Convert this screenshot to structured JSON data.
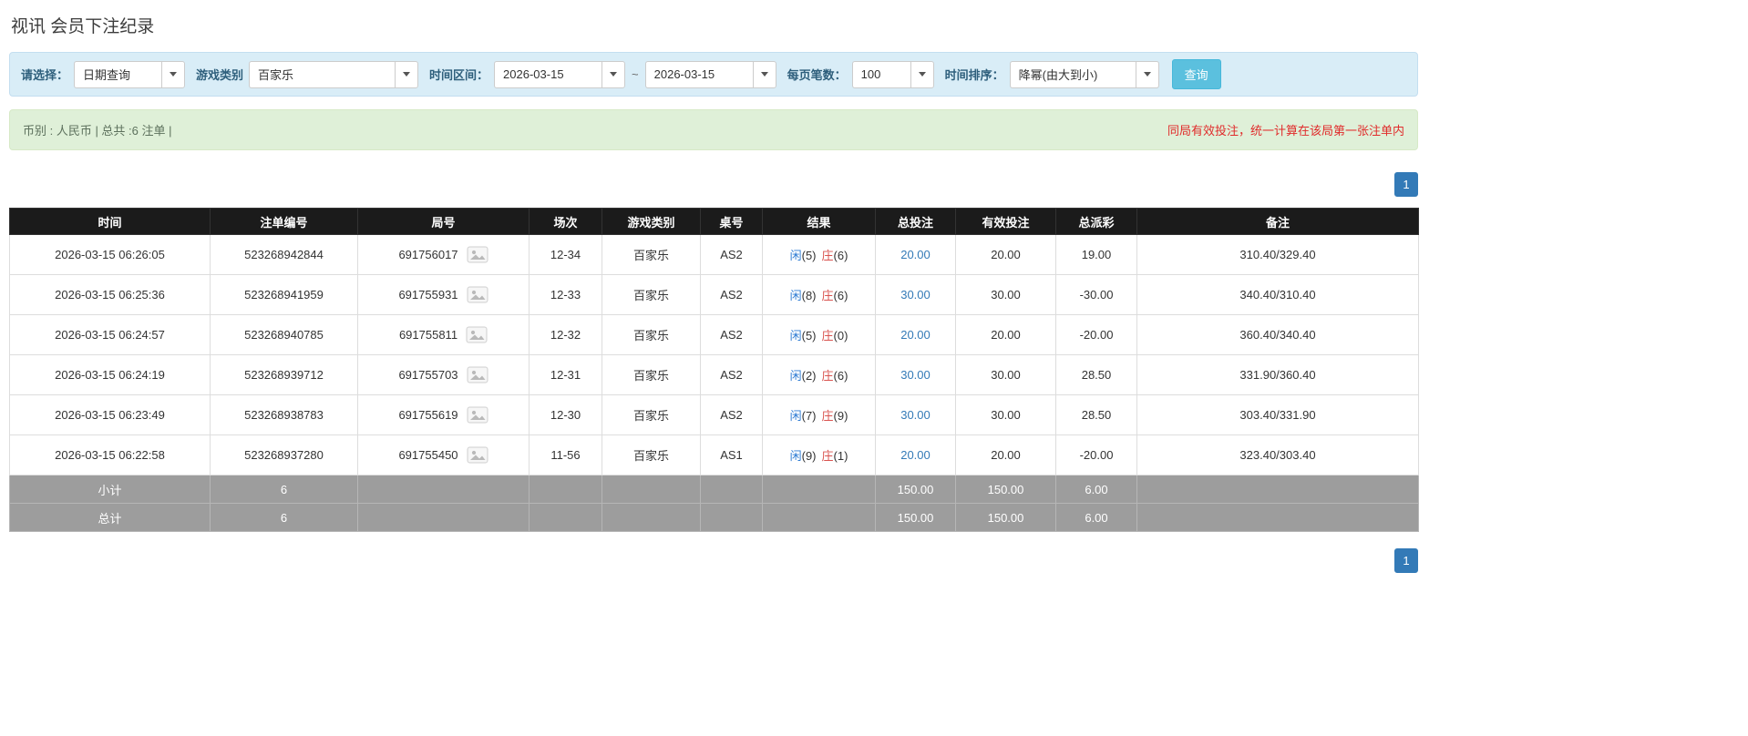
{
  "page": {
    "title": "视讯 会员下注纪录"
  },
  "filters": {
    "select_label": "请选择：",
    "select_value": "日期查询",
    "game_label": "游戏类别",
    "game_value": "百家乐",
    "range_label": "时间区间：",
    "date_from": "2026-03-15",
    "range_separator": "~",
    "date_to": "2026-03-15",
    "page_size_label": "每页笔数：",
    "page_size_value": "100",
    "sort_label": "时间排序：",
    "sort_value": "降幂(由大到小)",
    "search_button_label": "查询"
  },
  "summary": {
    "info": "币别 : 人民币 | 总共 :6 注单 |",
    "note": "同局有效投注，统一计算在该局第一张注单内"
  },
  "pagination": {
    "top": "1",
    "bottom": "1"
  },
  "table": {
    "headers": [
      "时间",
      "注单编号",
      "局号",
      "场次",
      "游戏类别",
      "桌号",
      "结果",
      "总投注",
      "有效投注",
      "总派彩",
      "备注"
    ],
    "rows": [
      {
        "time": "2026-03-15 06:26:05",
        "bet_id": "523268942844",
        "round_no": "691756017",
        "session": "12-34",
        "game": "百家乐",
        "table_no": "AS2",
        "p_label": "闲",
        "p_num": "(5)",
        "b_label": "庄",
        "b_num": "(6)",
        "total_bet": "20.00",
        "valid_bet": "20.00",
        "payout": "19.00",
        "remark": "310.40/329.40"
      },
      {
        "time": "2026-03-15 06:25:36",
        "bet_id": "523268941959",
        "round_no": "691755931",
        "session": "12-33",
        "game": "百家乐",
        "table_no": "AS2",
        "p_label": "闲",
        "p_num": "(8)",
        "b_label": "庄",
        "b_num": "(6)",
        "total_bet": "30.00",
        "valid_bet": "30.00",
        "payout": "-30.00",
        "remark": "340.40/310.40"
      },
      {
        "time": "2026-03-15 06:24:57",
        "bet_id": "523268940785",
        "round_no": "691755811",
        "session": "12-32",
        "game": "百家乐",
        "table_no": "AS2",
        "p_label": "闲",
        "p_num": "(5)",
        "b_label": "庄",
        "b_num": "(0)",
        "total_bet": "20.00",
        "valid_bet": "20.00",
        "payout": "-20.00",
        "remark": "360.40/340.40"
      },
      {
        "time": "2026-03-15 06:24:19",
        "bet_id": "523268939712",
        "round_no": "691755703",
        "session": "12-31",
        "game": "百家乐",
        "table_no": "AS2",
        "p_label": "闲",
        "p_num": "(2)",
        "b_label": "庄",
        "b_num": "(6)",
        "total_bet": "30.00",
        "valid_bet": "30.00",
        "payout": "28.50",
        "remark": "331.90/360.40"
      },
      {
        "time": "2026-03-15 06:23:49",
        "bet_id": "523268938783",
        "round_no": "691755619",
        "session": "12-30",
        "game": "百家乐",
        "table_no": "AS2",
        "p_label": "闲",
        "p_num": "(7)",
        "b_label": "庄",
        "b_num": "(9)",
        "total_bet": "30.00",
        "valid_bet": "30.00",
        "payout": "28.50",
        "remark": "303.40/331.90"
      },
      {
        "time": "2026-03-15 06:22:58",
        "bet_id": "523268937280",
        "round_no": "691755450",
        "session": "11-56",
        "game": "百家乐",
        "table_no": "AS1",
        "p_label": "闲",
        "p_num": "(9)",
        "b_label": "庄",
        "b_num": "(1)",
        "total_bet": "20.00",
        "valid_bet": "20.00",
        "payout": "-20.00",
        "remark": "323.40/303.40"
      }
    ],
    "footer_rows": [
      {
        "label": "小计",
        "count": "6",
        "total_bet": "150.00",
        "valid_bet": "150.00",
        "payout": "6.00"
      },
      {
        "label": "总计",
        "count": "6",
        "total_bet": "150.00",
        "valid_bet": "150.00",
        "payout": "6.00"
      }
    ]
  },
  "colors": {
    "accent_blue": "#337ab7",
    "search_button_bg": "#5bc0de",
    "filter_bar_bg": "#d9edf7",
    "summary_bar_bg": "#dff0d8",
    "table_header_bg": "#1b1b1b",
    "table_footer_bg": "#9d9d9d",
    "negative_red": "#e02b2b",
    "player_blue": "#2d7bd3",
    "banker_red": "#d9534f"
  }
}
